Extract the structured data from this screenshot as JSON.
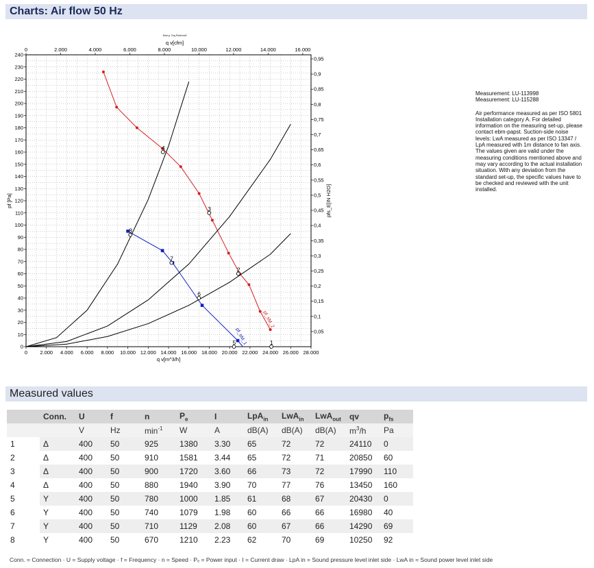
{
  "header": {
    "title": "Charts: Air flow 50 Hz"
  },
  "chart_data": {
    "type": "line",
    "title": "Dee.p 7xq Rcht.iw3",
    "xlabel": "q v[m^3/h]",
    "xlabel_top": "q v[cfm]",
    "ylabel": "pf [Pa]",
    "ylabel_right": "pfs_E[IN H2O]",
    "xlim": [
      0,
      28000
    ],
    "ylim": [
      0,
      240
    ],
    "x_ticks": [
      "0",
      "2.000",
      "4.000",
      "6.000",
      "8.000",
      "10.000",
      "12.000",
      "14.000",
      "16.000",
      "18.000",
      "20.000",
      "22.000",
      "24.000",
      "26.000",
      "28.000"
    ],
    "x_top_ticks": [
      "0",
      "2.000",
      "4.000",
      "6.000",
      "8.000",
      "10.000",
      "12.000",
      "14.000",
      "16.000"
    ],
    "y_ticks": [
      "0",
      "10",
      "20",
      "30",
      "40",
      "50",
      "60",
      "70",
      "80",
      "90",
      "100",
      "110",
      "120",
      "130",
      "140",
      "150",
      "160",
      "170",
      "180",
      "190",
      "200",
      "210",
      "220",
      "230",
      "240"
    ],
    "y_right_ticks": [
      "0,05",
      "0,1",
      "0,15",
      "0,2",
      "0,25",
      "0,3",
      "0,35",
      "0,4",
      "0,45",
      "0,5",
      "0,55",
      "0,6",
      "0,65",
      "0,7",
      "0,75",
      "0,8",
      "0,85",
      "0,9",
      "0,95"
    ],
    "series": [
      {
        "name": "pf_sM_2",
        "color": "#d42020",
        "x": [
          7600,
          8900,
          10900,
          13400,
          15200,
          17000,
          18300,
          19900,
          21000,
          21900,
          23000,
          24000
        ],
        "y": [
          226,
          197,
          180,
          163,
          148,
          126,
          104,
          77,
          60,
          51,
          29,
          14
        ]
      },
      {
        "name": "pf_sM_1",
        "color": "#1020c0",
        "x": [
          10000,
          13400,
          14400,
          17300,
          20800,
          21300
        ],
        "y": [
          95,
          79,
          69,
          34,
          5,
          0
        ]
      },
      {
        "name": "",
        "color": "#000000",
        "x": [
          0,
          3000,
          6000,
          9000,
          12000,
          14000,
          16000
        ],
        "y": [
          0,
          7.5,
          30,
          68,
          121,
          165,
          218
        ]
      },
      {
        "name": "",
        "color": "#000000",
        "x": [
          0,
          4000,
          8000,
          12000,
          16000,
          20000,
          24000,
          26000
        ],
        "y": [
          0,
          4.3,
          17,
          38.5,
          68,
          107,
          154,
          183
        ]
      },
      {
        "name": "",
        "color": "#000000",
        "x": [
          0,
          4000,
          8000,
          12000,
          16000,
          20000,
          24000,
          26000
        ],
        "y": [
          0,
          2.1,
          8.4,
          19,
          34,
          53,
          76,
          93
        ]
      }
    ],
    "operating_points": [
      {
        "label": "1",
        "x": 24100,
        "y": 0
      },
      {
        "label": "2",
        "x": 20850,
        "y": 60
      },
      {
        "label": "3",
        "x": 17990,
        "y": 110
      },
      {
        "label": "4",
        "x": 13450,
        "y": 160
      },
      {
        "label": "5",
        "x": 20430,
        "y": 0
      },
      {
        "label": "6",
        "x": 16980,
        "y": 40
      },
      {
        "label": "7",
        "x": 14290,
        "y": 69
      },
      {
        "label": "8",
        "x": 10250,
        "y": 92
      }
    ],
    "grid": true
  },
  "notes": {
    "measurement_1": "Measurement: LU-113998",
    "measurement_2": "Measurement: LU-115288",
    "description": "Air performance measured as per ISO 5801 Installation category A. For detailed information on the measuring set-up, please contact ebm-papst. Suction-side noise levels: LwA measured as per ISO 13347 / LpA measured with 1m distance to fan axis. The values given are valid under the measuring conditions mentioned above and may vary according to the actual installation situation. With any deviation from the standard set-up, the specific values have to be checked and reviewed with the unit installed."
  },
  "measured": {
    "title": "Measured values",
    "headers": [
      {
        "t": "",
        "s": ""
      },
      {
        "t": "Conn.",
        "s": ""
      },
      {
        "t": "U",
        "s": ""
      },
      {
        "t": "f",
        "s": ""
      },
      {
        "t": "n",
        "s": ""
      },
      {
        "t": "P",
        "s": "e"
      },
      {
        "t": "I",
        "s": ""
      },
      {
        "t": "LpA",
        "s": "in"
      },
      {
        "t": "LwA",
        "s": "in"
      },
      {
        "t": "LwA",
        "s": "out"
      },
      {
        "t": "qv",
        "s": ""
      },
      {
        "t": "p",
        "s": "fs"
      }
    ],
    "units": [
      {
        "t": "",
        "s": ""
      },
      {
        "t": "",
        "s": ""
      },
      {
        "t": "V",
        "s": ""
      },
      {
        "t": "Hz",
        "s": ""
      },
      {
        "t": "min",
        "s": "-1"
      },
      {
        "t": "W",
        "s": ""
      },
      {
        "t": "A",
        "s": ""
      },
      {
        "t": "dB(A)",
        "s": ""
      },
      {
        "t": "dB(A)",
        "s": ""
      },
      {
        "t": "dB(A)",
        "s": ""
      },
      {
        "t": "m",
        "s": "3/h"
      },
      {
        "t": "Pa",
        "s": ""
      }
    ],
    "rows": [
      [
        "1",
        "Δ",
        "400",
        "50",
        "925",
        "1380",
        "3.30",
        "65",
        "72",
        "72",
        "24110",
        "0"
      ],
      [
        "2",
        "Δ",
        "400",
        "50",
        "910",
        "1581",
        "3.44",
        "65",
        "72",
        "71",
        "20850",
        "60"
      ],
      [
        "3",
        "Δ",
        "400",
        "50",
        "900",
        "1720",
        "3.60",
        "66",
        "73",
        "72",
        "17990",
        "110"
      ],
      [
        "4",
        "Δ",
        "400",
        "50",
        "880",
        "1940",
        "3.90",
        "70",
        "77",
        "76",
        "13450",
        "160"
      ],
      [
        "5",
        "Y",
        "400",
        "50",
        "780",
        "1000",
        "1.85",
        "61",
        "68",
        "67",
        "20430",
        "0"
      ],
      [
        "6",
        "Y",
        "400",
        "50",
        "740",
        "1079",
        "1.98",
        "60",
        "66",
        "66",
        "16980",
        "40"
      ],
      [
        "7",
        "Y",
        "400",
        "50",
        "710",
        "1129",
        "2.08",
        "60",
        "67",
        "66",
        "14290",
        "69"
      ],
      [
        "8",
        "Y",
        "400",
        "50",
        "670",
        "1210",
        "2.23",
        "62",
        "70",
        "69",
        "10250",
        "92"
      ]
    ],
    "footnote": "Conn. = Connection · U = Supply voltage · f = Frequency · n = Speed · Pₑ = Power input · I = Current draw · LpA in = Sound pressure level inlet side · LwA in = Sound power level inlet side"
  }
}
